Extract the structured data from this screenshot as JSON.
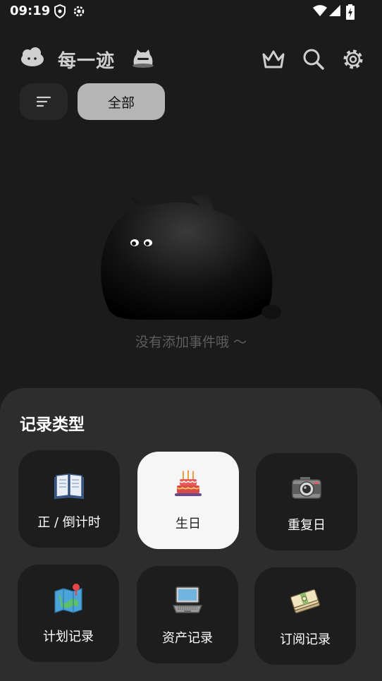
{
  "status_bar": {
    "time": "09:19"
  },
  "header": {
    "title": "每一迹"
  },
  "filters": {
    "all_chip": "全部"
  },
  "empty_state": {
    "message": "没有添加事件哦 ～"
  },
  "sheet": {
    "title": "记录类型",
    "types": [
      {
        "label": "正 / 倒计时",
        "icon": "book-icon",
        "selected": false
      },
      {
        "label": "生日",
        "icon": "birthday-cake-icon",
        "selected": true
      },
      {
        "label": "重复日",
        "icon": "camera-icon",
        "selected": false
      },
      {
        "label": "计划记录",
        "icon": "map-pin-icon",
        "selected": false
      },
      {
        "label": "资产记录",
        "icon": "laptop-icon",
        "selected": false
      },
      {
        "label": "订阅记录",
        "icon": "money-icon",
        "selected": false
      }
    ]
  },
  "colors": {
    "background": "#1b1b1b",
    "sheet": "#2d2d2d",
    "card": "#1d1d1d",
    "selected_card": "#f6f6f6",
    "chip": "#b5b5b5"
  }
}
